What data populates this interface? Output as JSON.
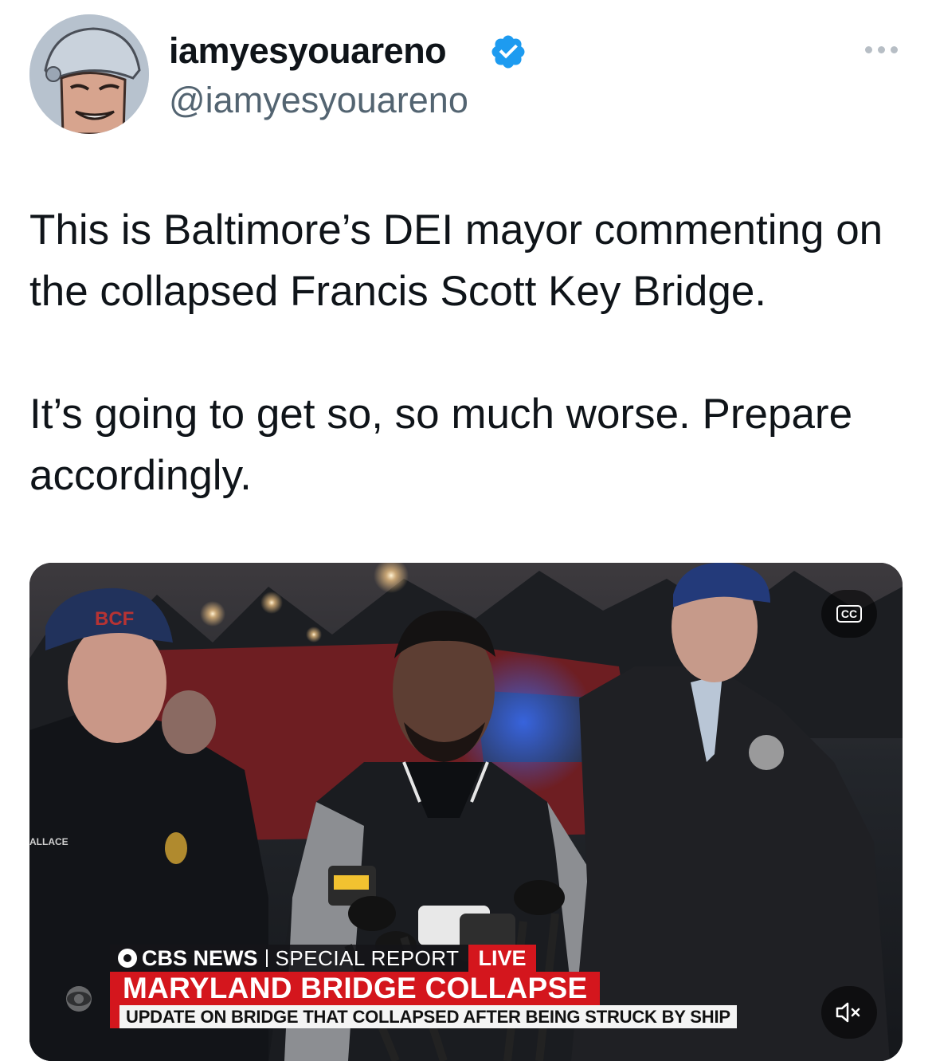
{
  "author": {
    "display_name": "iamyesyouareno",
    "handle": "@iamyesyouareno",
    "verified": true,
    "avatar_icon": "cartoon-helmet-avatar"
  },
  "tweet": {
    "paragraphs": [
      "This is Baltimore’s DEI mayor commenting on the collapsed Francis Scott Key Bridge.",
      "It’s going to get so, so much worse. Prepare accordingly."
    ]
  },
  "video": {
    "cc_label": "CC",
    "hat_text": "BCF",
    "jacket_text": "ALLACE",
    "lower_third": {
      "brand": "CBS NEWS",
      "segment": "SPECIAL REPORT",
      "live": "LIVE",
      "headline": "MARYLAND BRIDGE COLLAPSE",
      "subline": "UPDATE ON BRIDGE THAT COLLAPSED AFTER BEING STRUCK BY SHIP"
    }
  },
  "colors": {
    "text_primary": "#0f1419",
    "text_secondary": "#536471",
    "verified_blue": "#1d9bf0",
    "cbs_red": "#d4161d"
  }
}
